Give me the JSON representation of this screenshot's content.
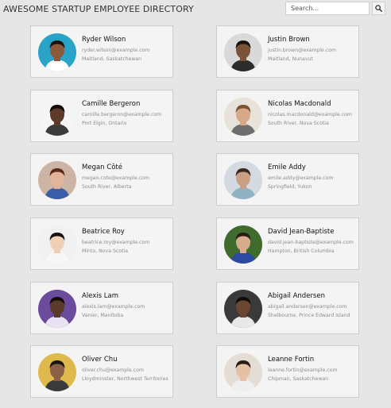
{
  "header": {
    "title": "AWESOME STARTUP EMPLOYEE DIRECTORY"
  },
  "search": {
    "placeholder": "Search..."
  },
  "employees": [
    {
      "name": "Ryder Wilson",
      "email": "ryder.wilson@example.com",
      "location": "Maitland, Saskatchewan",
      "bg": "#2aa3c8",
      "skin": "#8a5a3b",
      "hair": "#1c120c",
      "shirt": "#ffffff"
    },
    {
      "name": "Justin Brown",
      "email": "justin.brown@example.com",
      "location": "Maitland, Nunavut",
      "bg": "#d9d9d9",
      "skin": "#7a5238",
      "hair": "#1a1411",
      "shirt": "#2c2c2c"
    },
    {
      "name": "Camille Bergeron",
      "email": "camille.bergeron@example.com",
      "location": "Port Elgin, Ontario",
      "bg": "#f5f5f5",
      "skin": "#5d3b28",
      "hair": "#120c09",
      "shirt": "#3b3b3b"
    },
    {
      "name": "Nicolas Macdonald",
      "email": "nicolas.macdonald@example.com",
      "location": "South River, Nova Scotia",
      "bg": "#e7e2da",
      "skin": "#d7a888",
      "hair": "#7a5533",
      "shirt": "#6e6e6e"
    },
    {
      "name": "Megan Côté",
      "email": "megan.cote@example.com",
      "location": "South River, Alberta",
      "bg": "#cdb5a5",
      "skin": "#e2b49a",
      "hair": "#5a2a1a",
      "shirt": "#3b5ea8"
    },
    {
      "name": "Emile Addy",
      "email": "emile.addy@example.com",
      "location": "Springfield, Yukon",
      "bg": "#d4dadf",
      "skin": "#caa084",
      "hair": "#3b2a1f",
      "shirt": "#8fb3c4"
    },
    {
      "name": "Beatrice Roy",
      "email": "beatrice.roy@example.com",
      "location": "Minto, Nova Scotia",
      "bg": "#f1f1f1",
      "skin": "#f0d0b5",
      "hair": "#1a1410",
      "shirt": "#f7f7f7"
    },
    {
      "name": "David Jean-Baptiste",
      "email": "david.jean-baptiste@example.com",
      "location": "Hampton, British Columbia",
      "bg": "#3f6b2f",
      "skin": "#d7ac8c",
      "hair": "#2a1c12",
      "shirt": "#2b4aa0"
    },
    {
      "name": "Alexis Lam",
      "email": "alexis.lam@example.com",
      "location": "Vanier, Manitoba",
      "bg": "#6a4b9c",
      "skin": "#5a3a2a",
      "hair": "#120b08",
      "shirt": "#e9e2f3"
    },
    {
      "name": "Abigail Andersen",
      "email": "abigail.andersen@example.com",
      "location": "Shelbourne, Prince Edward Island",
      "bg": "#3a3a3a",
      "skin": "#6b4630",
      "hair": "#120c09",
      "shirt": "#e8e8e8"
    },
    {
      "name": "Oliver Chu",
      "email": "oliver.chu@example.com",
      "location": "Lloydminster, Northwest Territories",
      "bg": "#e0b94c",
      "skin": "#8a6046",
      "hair": "#1a1410",
      "shirt": "#3a3a3a"
    },
    {
      "name": "Leanne Fortin",
      "email": "leanne.fortin@example.com",
      "location": "Chipman, Saskatchewan",
      "bg": "#e3ddd6",
      "skin": "#e6c0a4",
      "hair": "#2a1b14",
      "shirt": "#efefef"
    }
  ]
}
